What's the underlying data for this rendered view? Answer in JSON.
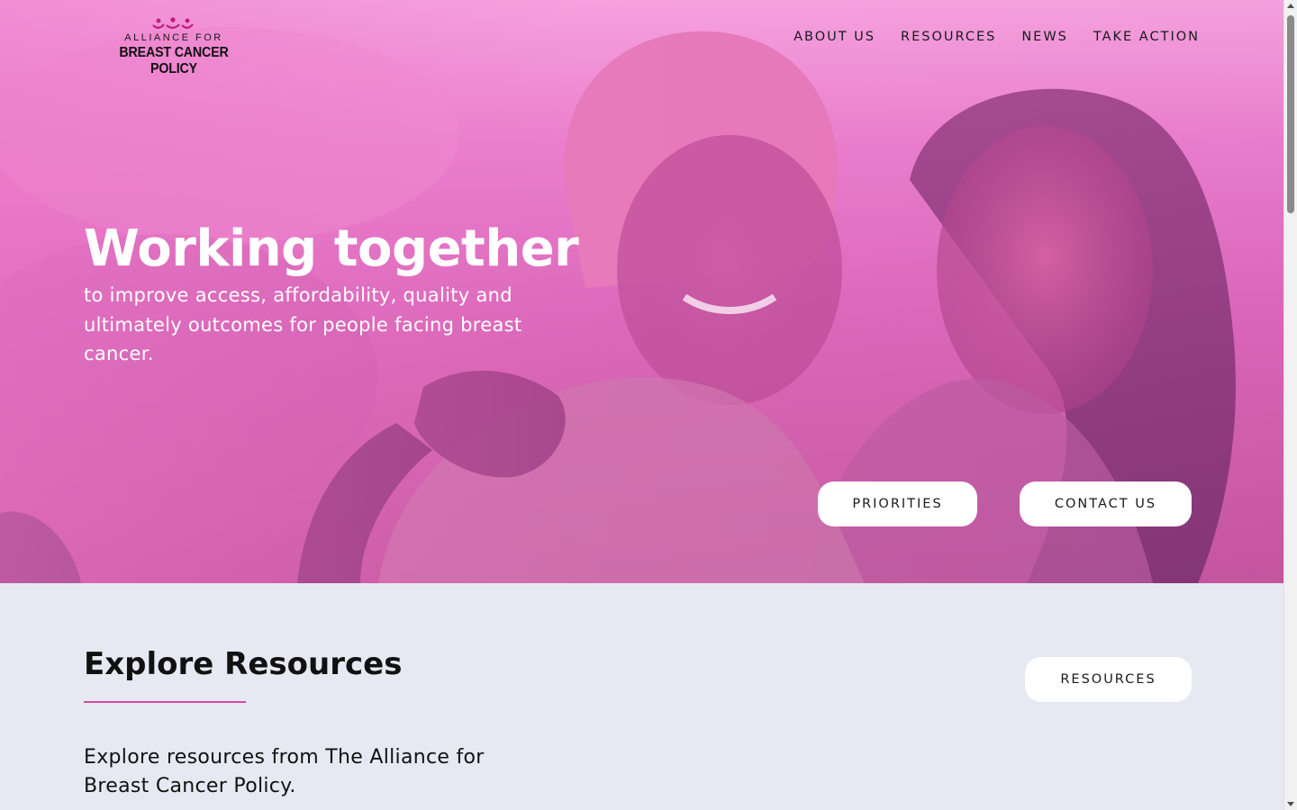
{
  "logo": {
    "line1": "ALLIANCE FOR",
    "line2": "BREAST CANCER POLICY"
  },
  "nav": {
    "items": [
      {
        "label": "ABOUT US"
      },
      {
        "label": "RESOURCES"
      },
      {
        "label": "NEWS"
      },
      {
        "label": "TAKE ACTION"
      }
    ]
  },
  "hero": {
    "title": "Working together",
    "subtitle": "to improve access, affordability, quality and ultimately outcomes for people facing breast cancer.",
    "buttons": {
      "priorities": "PRIORITIES",
      "contact": "CONTACT US"
    }
  },
  "resources_section": {
    "title": "Explore Resources",
    "text": "Explore resources from The Alliance for Breast Cancer Policy.",
    "button": "RESOURCES"
  },
  "colors": {
    "accent": "#d9479f",
    "hero_pink": "#ea7fce",
    "section_bg": "#e6e9f2"
  }
}
